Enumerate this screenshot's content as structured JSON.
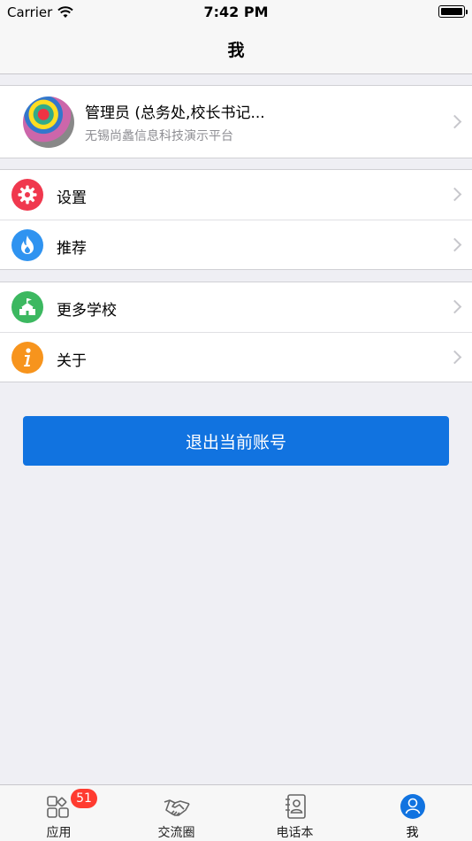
{
  "status_bar": {
    "carrier": "Carrier",
    "time": "7:42 PM"
  },
  "nav": {
    "title": "我"
  },
  "profile": {
    "name": "管理员 (总务处,校长书记...",
    "organization": "无锡尚蠡信息科技演示平台"
  },
  "menu_group_1": [
    {
      "label": "设置",
      "icon": "gear-icon",
      "color": "#f0384e"
    },
    {
      "label": "推荐",
      "icon": "flame-icon",
      "color": "#2f93f0"
    }
  ],
  "menu_group_2": [
    {
      "label": "更多学校",
      "icon": "school-icon",
      "color": "#3cb860"
    },
    {
      "label": "关于",
      "icon": "info-icon",
      "color": "#f7941d"
    }
  ],
  "logout_label": "退出当前账号",
  "tabs": [
    {
      "label": "应用",
      "icon": "apps-icon",
      "badge": "51"
    },
    {
      "label": "交流圈",
      "icon": "handshake-icon"
    },
    {
      "label": "电话本",
      "icon": "contacts-icon"
    },
    {
      "label": "我",
      "icon": "person-icon",
      "active": true
    }
  ],
  "colors": {
    "accent": "#1173e0",
    "badge": "#ff3b30",
    "background": "#efeff4"
  }
}
